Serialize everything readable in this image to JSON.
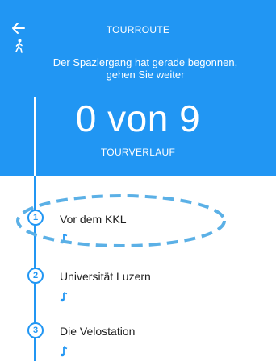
{
  "header": {
    "title": "TOURROUTE",
    "subtitle_line1": "Der Spaziergang hat gerade begonnen,",
    "subtitle_line2": "gehen Sie weiter",
    "progress": "0 von 9",
    "section_label": "TOURVERLAUF",
    "back_icon": "arrow-left-icon",
    "walker_icon": "walking-person-icon"
  },
  "stops": [
    {
      "number": "1",
      "name": "Vor dem KKL",
      "icon": "music-note-icon"
    },
    {
      "number": "2",
      "name": "Universität Luzern",
      "icon": "music-note-icon"
    },
    {
      "number": "3",
      "name": "Die Velostation",
      "icon": "music-note-icon"
    }
  ],
  "colors": {
    "accent": "#2196f3",
    "highlight": "#5bb0e6"
  }
}
